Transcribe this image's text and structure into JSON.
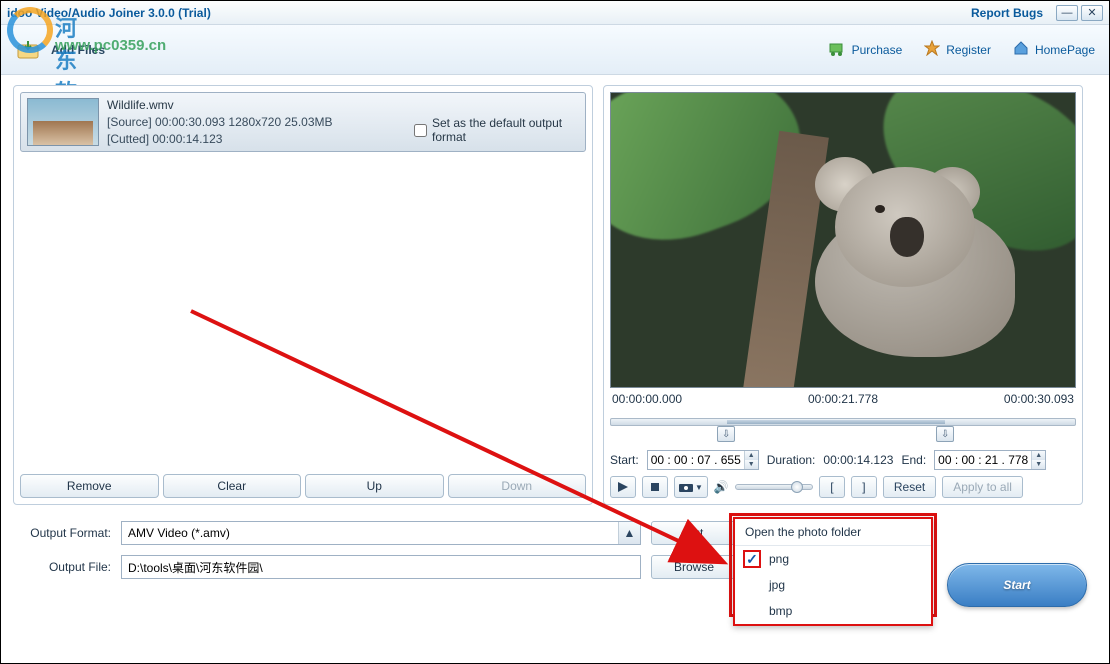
{
  "title": "idoo Video/Audio Joiner 3.0.0 (Trial)",
  "report_bugs": "Report Bugs",
  "watermark": {
    "cn": "河东软件园",
    "url": "www.pc0359.cn"
  },
  "toolbar": {
    "add_files": "Add Files",
    "purchase": "Purchase",
    "register": "Register",
    "homepage": "HomePage"
  },
  "file": {
    "name": "Wildlife.wmv",
    "source_line": "[Source]  00:00:30.093  1280x720  25.03MB",
    "cutted_line": "[Cutted]  00:00:14.123",
    "default_output_label": "Set as the default output format"
  },
  "buttons": {
    "remove": "Remove",
    "clear": "Clear",
    "up": "Up",
    "down": "Down"
  },
  "times": {
    "t0": "00:00:00.000",
    "tcur": "00:00:21.778",
    "tend": "00:00:30.093"
  },
  "range": {
    "start_label": "Start:",
    "start_val": "00 : 00 : 07 . 655",
    "duration_label": "Duration:",
    "duration_val": "00:00:14.123",
    "end_label": "End:",
    "end_val": "00 : 00 : 21 . 778"
  },
  "controls": {
    "reset": "Reset",
    "apply_all": "Apply to all"
  },
  "output": {
    "format_label": "Output Format:",
    "format_value": "AMV Video (*.amv)",
    "cut_btn": "Cut",
    "file_label": "Output File:",
    "file_value": "D:\\tools\\桌面\\河东软件园\\",
    "browse_btn": "Browse"
  },
  "start": "Start",
  "popup": {
    "header": "Open the photo folder",
    "opt1": "png",
    "opt2": "jpg",
    "opt3": "bmp",
    "check": "✓"
  }
}
